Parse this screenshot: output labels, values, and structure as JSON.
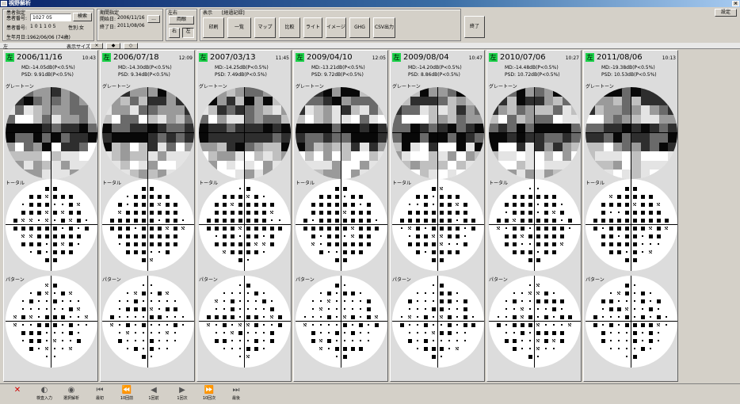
{
  "window": {
    "title": "視野解析"
  },
  "patient": {
    "group_label": "患者指定",
    "id_label": "患者番号:",
    "id_value": "1027 05",
    "search_label": "検索",
    "name_label": "患者番号:",
    "name_value": "1 0 1 1 0 5",
    "sex_label": "性別:",
    "sex_value": "女",
    "birth_label": "生年月日:",
    "birth_value": "1962/06/06 (74歳)"
  },
  "period": {
    "group_label": "期間指定",
    "start_label": "開始日:",
    "start_value": "2006/11/16",
    "end_label": "終了日:",
    "end_value": "2011/08/06",
    "picker_label": "..."
  },
  "eye_select": {
    "group_label": "左右",
    "both_label": "両眼",
    "right_label": "右",
    "left_label": "左"
  },
  "display": {
    "group_label": "表示",
    "sub_label": "[経過記録]",
    "buttons": [
      "印刷",
      "一覧",
      "マップ",
      "比較",
      "ライト",
      "イメージ",
      "GHG",
      "CSV出力"
    ]
  },
  "end_label": "終了",
  "settings_label": "設定",
  "tabs": {
    "left_tab": "左",
    "size_label": "表示サイズ:",
    "size_btn1": "×",
    "size_btn2": "◆",
    "size_btn3": "◇"
  },
  "labels": {
    "gray": "グレートーン",
    "total": "トータル",
    "pattern": "パターン"
  },
  "exams": [
    {
      "eye": "左",
      "date": "2006/11/16",
      "time": "10:43",
      "md": "MD:-14.05dB(P<0.5%)",
      "psd": "PSD: 9.91dB(P<0.5%)"
    },
    {
      "eye": "左",
      "date": "2006/07/18",
      "time": "12:09",
      "md": "MD:-14.30dB(P<0.5%)",
      "psd": "PSD: 9.34dB(P<0.5%)"
    },
    {
      "eye": "左",
      "date": "2007/03/13",
      "time": "11:45",
      "md": "MD:-14.25dB(P<0.5%)",
      "psd": "PSD: 7.49dB(P<0.5%)"
    },
    {
      "eye": "左",
      "date": "2009/04/10",
      "time": "12:05",
      "md": "MD:-13.21dB(P<0.5%)",
      "psd": "PSD: 9.72dB(P<0.5%)"
    },
    {
      "eye": "左",
      "date": "2009/08/04",
      "time": "10:47",
      "md": "MD:-14.20dB(P<0.5%)",
      "psd": "PSD: 8.86dB(P<0.5%)"
    },
    {
      "eye": "左",
      "date": "2010/07/06",
      "time": "10:27",
      "md": "MD:-14.48dB(P<0.5%)",
      "psd": "PSD: 10.72dB(P<0.5%)"
    },
    {
      "eye": "左",
      "date": "2011/08/06",
      "time": "10:13",
      "md": "MD:-19.38dB(P<0.5%)",
      "psd": "PSD: 10.53dB(P<0.5%)"
    }
  ],
  "nav": [
    "削除",
    "検査入力",
    "選択解析",
    "最初",
    "10回前",
    "1回前",
    "1回次",
    "10回次",
    "最後"
  ]
}
